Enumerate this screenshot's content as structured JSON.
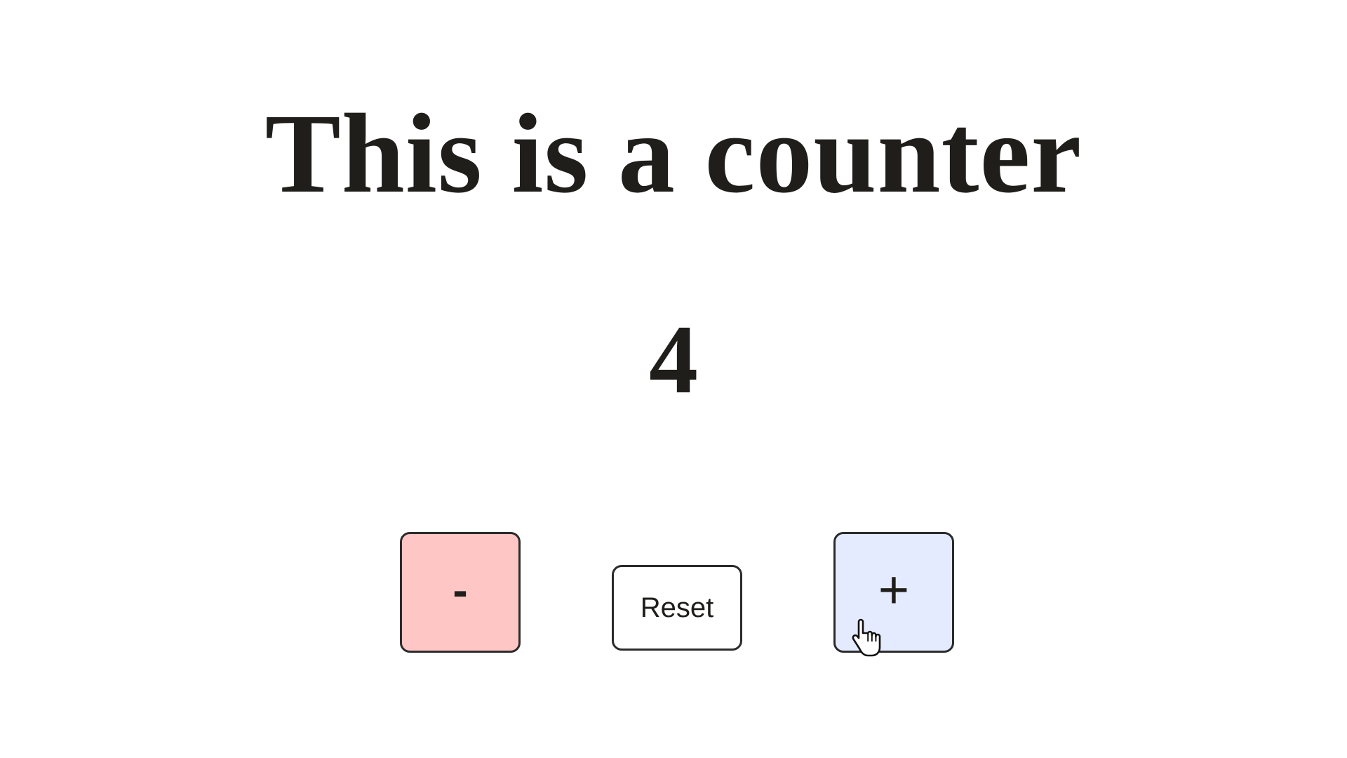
{
  "page": {
    "title": "This is a counter",
    "count": "4"
  },
  "buttons": {
    "decrement_label": "-",
    "reset_label": "Reset",
    "increment_label": "+"
  },
  "colors": {
    "decrement_bg": "#ffc6c6",
    "reset_bg": "#ffffff",
    "increment_bg": "#e5ebff",
    "text": "#1f1e1b",
    "border": "#2b2b2b"
  },
  "cursor": {
    "icon": "hand-pointer-icon"
  }
}
